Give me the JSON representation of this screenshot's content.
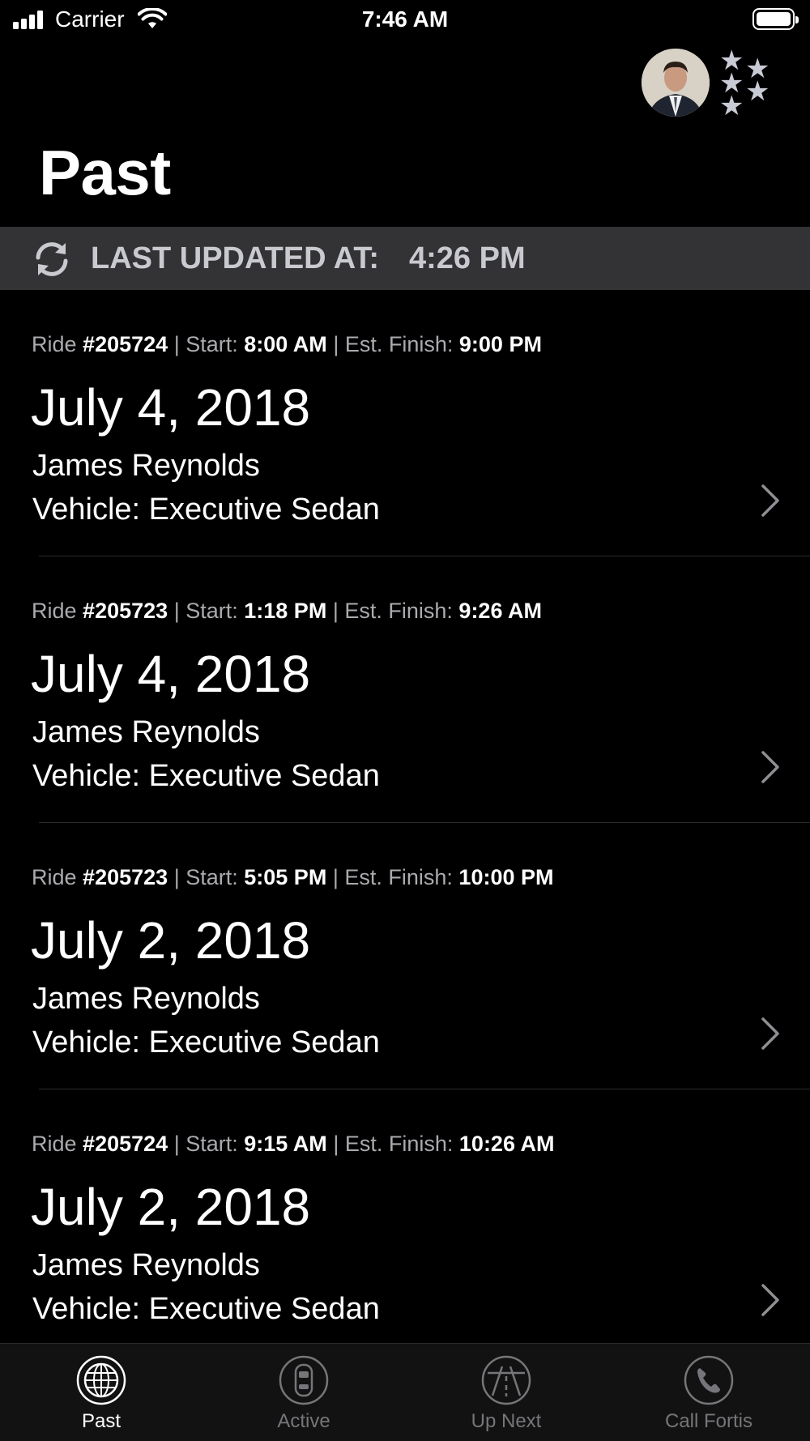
{
  "status_bar": {
    "carrier": "Carrier",
    "time": "7:46 AM"
  },
  "header": {
    "title": "Past",
    "rating_stars": 5
  },
  "update_banner": {
    "label": "LAST UPDATED AT:",
    "time": "4:26 PM"
  },
  "labels": {
    "ride": "Ride",
    "start": "Start:",
    "est_finish": "Est. Finish:",
    "separator": "|"
  },
  "rides": [
    {
      "ride_number": "#205724",
      "start": "8:00 AM",
      "est_finish": "9:00 PM",
      "date": "July 4, 2018",
      "passenger": "James Reynolds",
      "vehicle": "Vehicle: Executive Sedan"
    },
    {
      "ride_number": "#205723",
      "start": "1:18 PM",
      "est_finish": "9:26 AM",
      "date": "July 4, 2018",
      "passenger": "James Reynolds",
      "vehicle": "Vehicle: Executive Sedan"
    },
    {
      "ride_number": "#205723",
      "start": "5:05 PM",
      "est_finish": "10:00 PM",
      "date": "July 2, 2018",
      "passenger": "James Reynolds",
      "vehicle": "Vehicle: Executive Sedan"
    },
    {
      "ride_number": "#205724",
      "start": "9:15 AM",
      "est_finish": "10:26 AM",
      "date": "July 2, 2018",
      "passenger": "James Reynolds",
      "vehicle": "Vehicle: Executive Sedan"
    }
  ],
  "tabs": [
    {
      "label": "Past",
      "icon": "globe-icon",
      "active": true
    },
    {
      "label": "Active",
      "icon": "car-icon",
      "active": false
    },
    {
      "label": "Up Next",
      "icon": "road-icon",
      "active": false
    },
    {
      "label": "Call Fortis",
      "icon": "phone-icon",
      "active": false
    }
  ],
  "colors": {
    "background": "#000000",
    "banner": "#333336",
    "muted_text": "#aaaaaf",
    "tab_inactive": "#76767a"
  }
}
